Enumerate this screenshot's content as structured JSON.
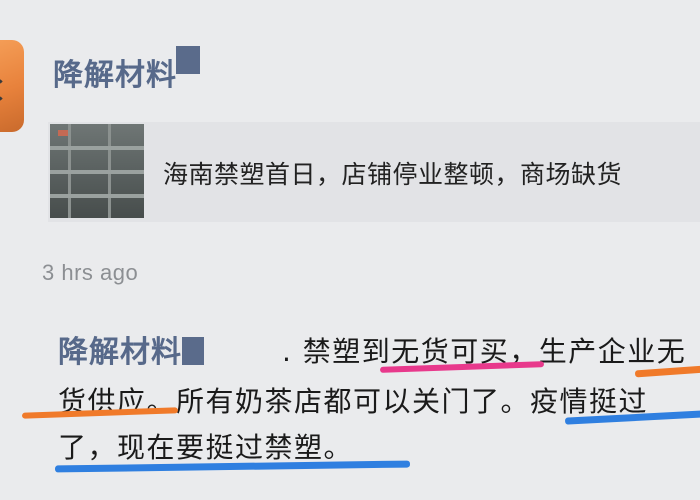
{
  "post": {
    "username": "降解材料"
  },
  "share_card": {
    "title": "海南禁塑首日，店铺停业整顿，商场缺货"
  },
  "timestamp": "3 hrs ago",
  "comment": {
    "username": "降解材料",
    "line1": ". 禁塑到无货可买，生产企业无",
    "line2": "货供应。所有奶茶店都可以关门了。疫情挺过",
    "line3": "了，现在要挺过禁塑。"
  },
  "colors": {
    "username": "#57698a",
    "highlight_pink": "#e8398c",
    "highlight_orange": "#f07a2a",
    "highlight_blue": "#2f7fe0"
  }
}
